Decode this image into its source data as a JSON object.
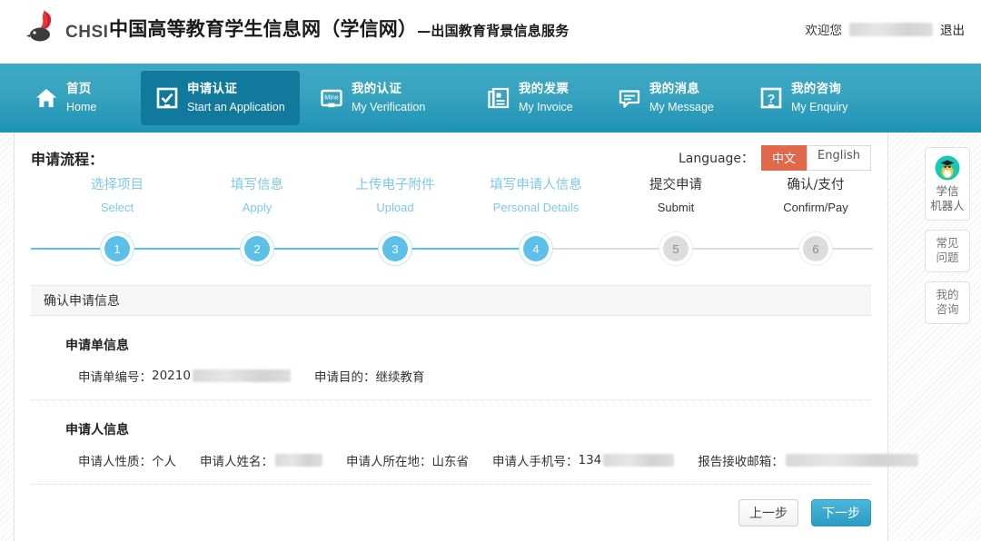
{
  "header": {
    "logo_text": "CHSI",
    "logo_icon": "chsi-bird-logo",
    "site_title_main": "中国高等教育学生信息网（学信网）",
    "site_title_dash": "—",
    "site_title_sub": "出国教育背景信息服务",
    "welcome_label": "欢迎您",
    "welcome_user_redacted": "",
    "logout_label": "退出"
  },
  "nav": {
    "items": [
      {
        "cn": "首页",
        "en": "Home",
        "icon": "home-icon",
        "active": false
      },
      {
        "cn": "申请认证",
        "en": "Start an Application",
        "icon": "checkbox-icon",
        "active": true
      },
      {
        "cn": "我的认证",
        "en": "My Verification",
        "icon": "mine-card-icon",
        "active": false
      },
      {
        "cn": "我的发票",
        "en": "My Invoice",
        "icon": "invoice-icon",
        "active": false
      },
      {
        "cn": "我的消息",
        "en": "My Message",
        "icon": "message-icon",
        "active": false
      },
      {
        "cn": "我的咨询",
        "en": "My Enquiry",
        "icon": "question-icon",
        "active": false
      }
    ]
  },
  "flow": {
    "title": "申请流程：",
    "language_label": "Language：",
    "lang_cn": "中文",
    "lang_en": "English",
    "lang_active": "中文",
    "accent_orange": "#e0684b",
    "accent_blue": "#5cc0e8",
    "steps": [
      {
        "num": "1",
        "cn": "选择项目",
        "en": "Select",
        "state": "done"
      },
      {
        "num": "2",
        "cn": "填写信息",
        "en": "Apply",
        "state": "done"
      },
      {
        "num": "3",
        "cn": "上传电子附件",
        "en": "Upload",
        "state": "done"
      },
      {
        "num": "4",
        "cn": "填写申请人信息",
        "en": "Personal Details",
        "state": "done"
      },
      {
        "num": "5",
        "cn": "提交申请",
        "en": "Submit",
        "state": "todo"
      },
      {
        "num": "6",
        "cn": "确认/支付",
        "en": "Confirm/Pay",
        "state": "todo"
      }
    ]
  },
  "content": {
    "section_title": "确认申请信息",
    "block1": {
      "title": "申请单信息",
      "fields": [
        {
          "label": "申请单编号：",
          "value": "20210",
          "redacted": true
        },
        {
          "label": "申请目的：",
          "value": "继续教育",
          "redacted": false
        }
      ]
    },
    "block2": {
      "title": "申请人信息",
      "fields": [
        {
          "label": "申请人性质：",
          "value": "个人",
          "redacted": false
        },
        {
          "label": "申请人姓名：",
          "value": "",
          "redacted": true
        },
        {
          "label": "申请人所在地：",
          "value": "山东省",
          "redacted": false
        },
        {
          "label": "申请人手机号：",
          "value": "134",
          "redacted": true
        },
        {
          "label": "报告接收邮箱：",
          "value": "",
          "redacted": true
        }
      ]
    }
  },
  "footer": {
    "prev_label": "上一步",
    "next_label": "下一步"
  },
  "side_widgets": [
    {
      "name": "robot",
      "icon": "graduate-bird-avatar",
      "line1": "学信",
      "line2": "机器人"
    },
    {
      "name": "faq",
      "icon": "",
      "line1": "常见",
      "line2": "问题"
    },
    {
      "name": "enquiry",
      "icon": "",
      "line1": "我的",
      "line2": "咨询"
    }
  ]
}
